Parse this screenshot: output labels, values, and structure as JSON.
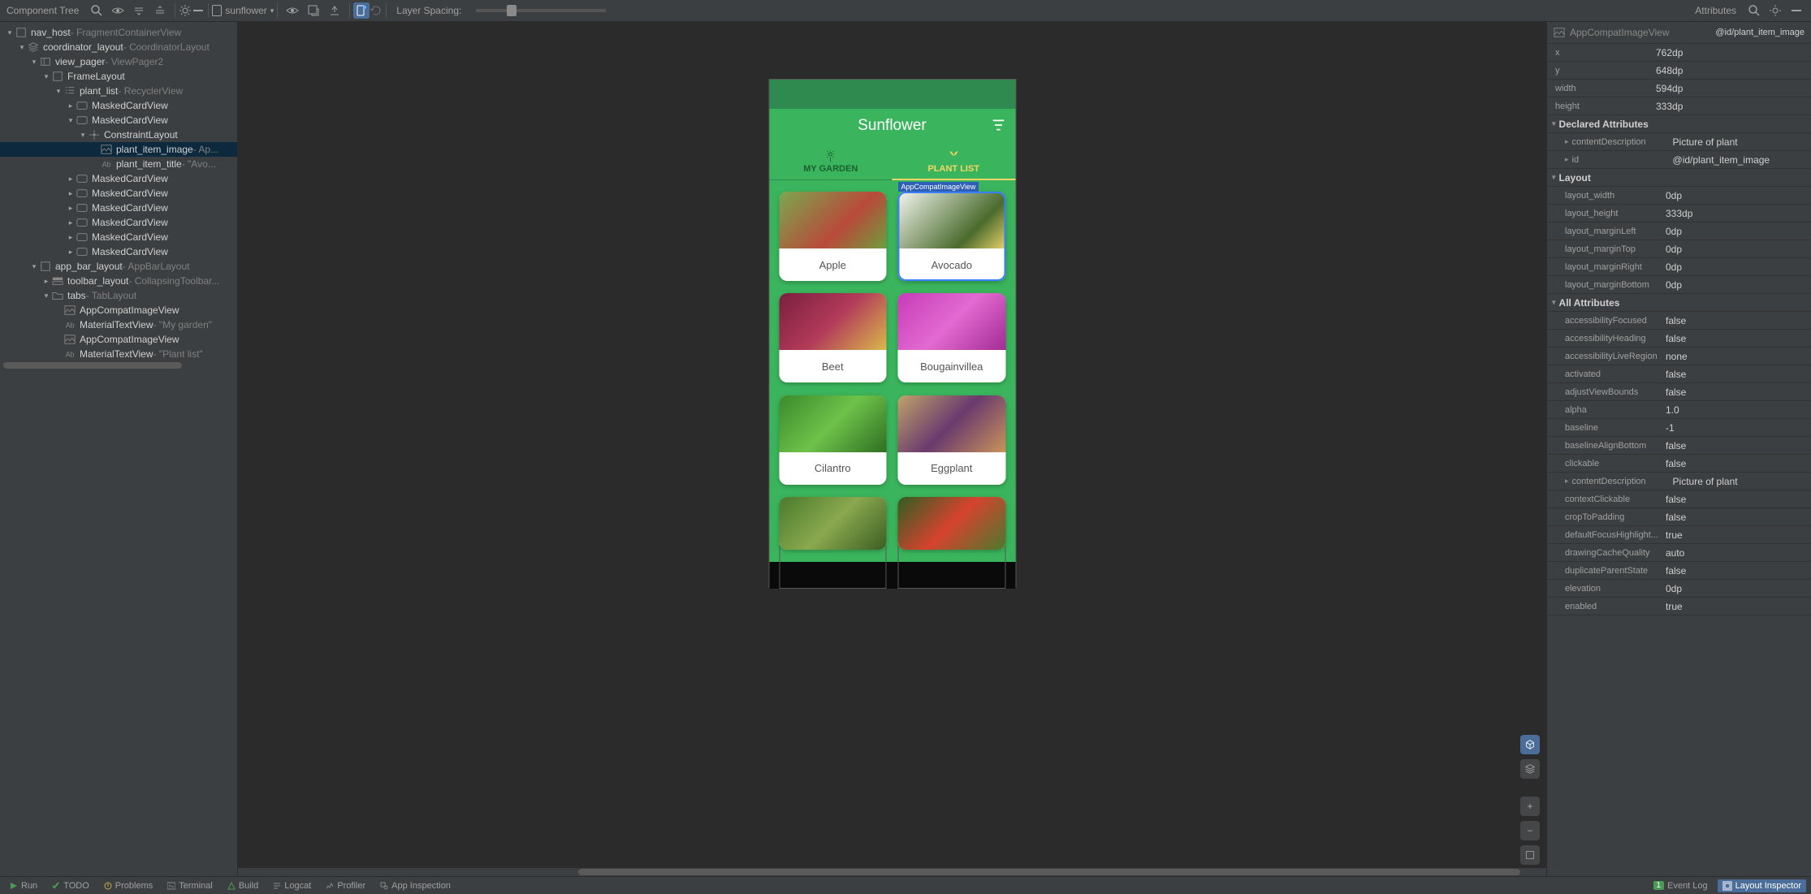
{
  "panels": {
    "tree": "Component Tree",
    "attributes": "Attributes"
  },
  "toolbar": {
    "device": "sunflower",
    "layer_label": "Layer Spacing:"
  },
  "tree": [
    {
      "d": 0,
      "tw": "▾",
      "icon": "box",
      "name": "nav_host",
      "desc": " - FragmentContainerView"
    },
    {
      "d": 1,
      "tw": "▾",
      "icon": "layers",
      "name": "coordinator_layout",
      "desc": " - CoordinatorLayout"
    },
    {
      "d": 2,
      "tw": "▾",
      "icon": "pager",
      "name": "view_pager",
      "desc": " - ViewPager2"
    },
    {
      "d": 3,
      "tw": "▾",
      "icon": "frame",
      "name": "FrameLayout",
      "desc": ""
    },
    {
      "d": 4,
      "tw": "▾",
      "icon": "list",
      "name": "plant_list",
      "desc": " - RecyclerView"
    },
    {
      "d": 5,
      "tw": "▸",
      "icon": "card",
      "name": "MaskedCardView",
      "desc": ""
    },
    {
      "d": 5,
      "tw": "▾",
      "icon": "card",
      "name": "MaskedCardView",
      "desc": ""
    },
    {
      "d": 6,
      "tw": "▾",
      "icon": "constraint",
      "name": "ConstraintLayout",
      "desc": ""
    },
    {
      "d": 7,
      "tw": "",
      "icon": "img",
      "name": "plant_item_image",
      "desc": " - Ap...",
      "sel": true
    },
    {
      "d": 7,
      "tw": "",
      "icon": "text",
      "name": "plant_item_title",
      "desc": " - \"Avo..."
    },
    {
      "d": 5,
      "tw": "▸",
      "icon": "card",
      "name": "MaskedCardView",
      "desc": ""
    },
    {
      "d": 5,
      "tw": "▸",
      "icon": "card",
      "name": "MaskedCardView",
      "desc": ""
    },
    {
      "d": 5,
      "tw": "▸",
      "icon": "card",
      "name": "MaskedCardView",
      "desc": ""
    },
    {
      "d": 5,
      "tw": "▸",
      "icon": "card",
      "name": "MaskedCardView",
      "desc": ""
    },
    {
      "d": 5,
      "tw": "▸",
      "icon": "card",
      "name": "MaskedCardView",
      "desc": ""
    },
    {
      "d": 5,
      "tw": "▸",
      "icon": "card",
      "name": "MaskedCardView",
      "desc": ""
    },
    {
      "d": 2,
      "tw": "▾",
      "icon": "box",
      "name": "app_bar_layout",
      "desc": " - AppBarLayout"
    },
    {
      "d": 3,
      "tw": "▸",
      "icon": "toolbar",
      "name": "toolbar_layout",
      "desc": " - CollapsingToolbar..."
    },
    {
      "d": 3,
      "tw": "▾",
      "icon": "folder",
      "name": "tabs",
      "desc": " - TabLayout"
    },
    {
      "d": 4,
      "tw": "",
      "icon": "img",
      "name": "AppCompatImageView",
      "desc": ""
    },
    {
      "d": 4,
      "tw": "",
      "icon": "text",
      "name": "MaterialTextView",
      "desc": " - \"My garden\""
    },
    {
      "d": 4,
      "tw": "",
      "icon": "img",
      "name": "AppCompatImageView",
      "desc": ""
    },
    {
      "d": 4,
      "tw": "",
      "icon": "text",
      "name": "MaterialTextView",
      "desc": " - \"Plant list\""
    }
  ],
  "phone": {
    "title": "Sunflower",
    "tabs": [
      {
        "label": "MY GARDEN"
      },
      {
        "label": "PLANT LIST"
      }
    ],
    "sel_tag": "AppCompatImageView",
    "cards": [
      {
        "label": "Apple",
        "grad": "linear-gradient(135deg,#7aa84e,#b84a3a 60%,#6e9e3c)"
      },
      {
        "label": "Avocado",
        "grad": "linear-gradient(135deg,#f4f6ef,#4a6b2d 70%,#e8d26a)",
        "sel": true
      },
      {
        "label": "Beet",
        "grad": "linear-gradient(135deg,#7a1f3e,#b33a5a,#d9b84a)"
      },
      {
        "label": "Bougainvillea",
        "grad": "linear-gradient(135deg,#c73bb8,#e26ad1,#a32c95)"
      },
      {
        "label": "Cilantro",
        "grad": "linear-gradient(135deg,#3a8a2c,#6ec24a,#2f6e22)"
      },
      {
        "label": "Eggplant",
        "grad": "linear-gradient(135deg,#bfa36a,#6a3a6e,#c9935a)"
      },
      {
        "label": "",
        "grad": "linear-gradient(135deg,#4a7a2c,#8aa84e,#3a5e22)",
        "partial": true
      },
      {
        "label": "",
        "grad": "linear-gradient(135deg,#2f5e22,#d6432e,#4a7a2c)",
        "partial": true
      }
    ]
  },
  "attrs": {
    "type": "AppCompatImageView",
    "id_ref": "@id/plant_item_image",
    "basic": [
      {
        "k": "x",
        "v": "762dp"
      },
      {
        "k": "y",
        "v": "648dp"
      },
      {
        "k": "width",
        "v": "594dp"
      },
      {
        "k": "height",
        "v": "333dp"
      }
    ],
    "sections": [
      {
        "title": "Declared Attributes",
        "rows": [
          {
            "k": "contentDescription",
            "v": "Picture of plant",
            "sub": "▸"
          },
          {
            "k": "id",
            "v": "@id/plant_item_image",
            "sub": "▸"
          }
        ]
      },
      {
        "title": "Layout",
        "rows": [
          {
            "k": "layout_width",
            "v": "0dp"
          },
          {
            "k": "layout_height",
            "v": "333dp"
          },
          {
            "k": "layout_marginLeft",
            "v": "0dp"
          },
          {
            "k": "layout_marginTop",
            "v": "0dp"
          },
          {
            "k": "layout_marginRight",
            "v": "0dp"
          },
          {
            "k": "layout_marginBottom",
            "v": "0dp"
          }
        ]
      },
      {
        "title": "All Attributes",
        "rows": [
          {
            "k": "accessibilityFocused",
            "v": "false"
          },
          {
            "k": "accessibilityHeading",
            "v": "false"
          },
          {
            "k": "accessibilityLiveRegion",
            "v": "none"
          },
          {
            "k": "activated",
            "v": "false"
          },
          {
            "k": "adjustViewBounds",
            "v": "false"
          },
          {
            "k": "alpha",
            "v": "1.0"
          },
          {
            "k": "baseline",
            "v": "-1"
          },
          {
            "k": "baselineAlignBottom",
            "v": "false"
          },
          {
            "k": "clickable",
            "v": "false"
          },
          {
            "k": "contentDescription",
            "v": "Picture of plant",
            "sub": "▸"
          },
          {
            "k": "contextClickable",
            "v": "false"
          },
          {
            "k": "cropToPadding",
            "v": "false"
          },
          {
            "k": "defaultFocusHighlight...",
            "v": "true"
          },
          {
            "k": "drawingCacheQuality",
            "v": "auto"
          },
          {
            "k": "duplicateParentState",
            "v": "false"
          },
          {
            "k": "elevation",
            "v": "0dp"
          },
          {
            "k": "enabled",
            "v": "true"
          }
        ]
      }
    ]
  },
  "bottom": {
    "items": [
      "Run",
      "TODO",
      "Problems",
      "Terminal",
      "Build",
      "Logcat",
      "Profiler",
      "App Inspection"
    ],
    "event_log": "Event Log",
    "event_count": "1",
    "inspector": "Layout Inspector"
  }
}
